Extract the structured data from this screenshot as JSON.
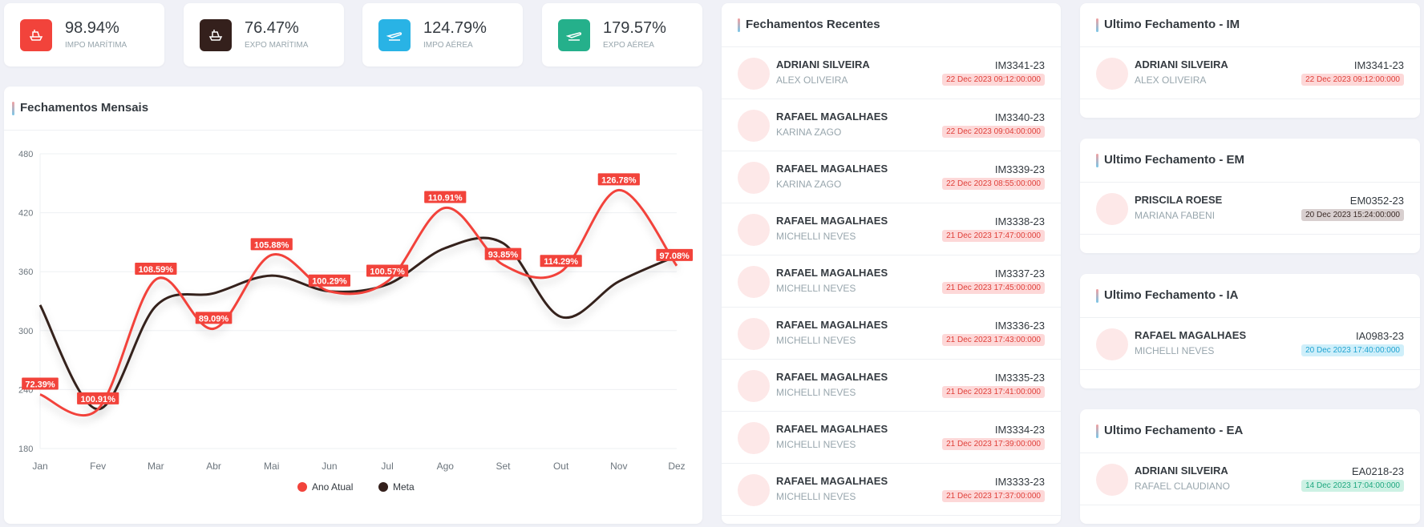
{
  "colors": {
    "red": "#f2433b",
    "dark": "#34201c",
    "blue": "#29b3e5",
    "green": "#25b08b"
  },
  "stats": [
    {
      "value": "98.94%",
      "label": "IMPO MARÍTIMA",
      "icon": "ship-icon",
      "color": "#f2433b"
    },
    {
      "value": "76.47%",
      "label": "EXPO MARÍTIMA",
      "icon": "ship-icon",
      "color": "#34201c"
    },
    {
      "value": "124.79%",
      "label": "IMPO AÉREA",
      "icon": "plane-icon",
      "color": "#29b3e5"
    },
    {
      "value": "179.57%",
      "label": "EXPO AÉREA",
      "icon": "plane-icon",
      "color": "#25b08b"
    }
  ],
  "monthly": {
    "title": "Fechamentos Mensais"
  },
  "chart_data": {
    "type": "line",
    "title": "",
    "categories": [
      "Jan",
      "Fev",
      "Mar",
      "Abr",
      "Mai",
      "Jun",
      "Jul",
      "Ago",
      "Set",
      "Out",
      "Nov",
      "Dez"
    ],
    "ylim": [
      180,
      480
    ],
    "yticks": [
      180,
      240,
      300,
      360,
      420,
      480
    ],
    "grid": true,
    "legend_position": "bottom",
    "series": [
      {
        "name": "Ano Atual",
        "color": "#f2433b",
        "values": [
          235,
          220,
          352,
          302,
          377,
          340,
          350,
          425,
          367,
          360,
          443,
          366
        ]
      },
      {
        "name": "Meta",
        "color": "#34201c",
        "values": [
          326,
          220,
          325,
          338,
          356,
          340,
          347,
          384,
          389,
          314,
          350,
          376
        ]
      }
    ],
    "data_labels": [
      "72.39%",
      "100.91%",
      "108.59%",
      "89.09%",
      "105.88%",
      "100.29%",
      "100.57%",
      "110.91%",
      "93.85%",
      "114.29%",
      "126.78%",
      "97.08%"
    ]
  },
  "recent": {
    "title": "Fechamentos Recentes",
    "items": [
      {
        "name": "ADRIANI SILVEIRA",
        "sub": "ALEX OLIVEIRA",
        "code": "IM3341-23",
        "date": "22 Dec 2023 09:12:00:000",
        "type": "im"
      },
      {
        "name": "RAFAEL MAGALHAES",
        "sub": "KARINA ZAGO",
        "code": "IM3340-23",
        "date": "22 Dec 2023 09:04:00:000",
        "type": "im"
      },
      {
        "name": "RAFAEL MAGALHAES",
        "sub": "KARINA ZAGO",
        "code": "IM3339-23",
        "date": "22 Dec 2023 08:55:00:000",
        "type": "im"
      },
      {
        "name": "RAFAEL MAGALHAES",
        "sub": "MICHELLI NEVES",
        "code": "IM3338-23",
        "date": "21 Dec 2023 17:47:00:000",
        "type": "im"
      },
      {
        "name": "RAFAEL MAGALHAES",
        "sub": "MICHELLI NEVES",
        "code": "IM3337-23",
        "date": "21 Dec 2023 17:45:00:000",
        "type": "im"
      },
      {
        "name": "RAFAEL MAGALHAES",
        "sub": "MICHELLI NEVES",
        "code": "IM3336-23",
        "date": "21 Dec 2023 17:43:00:000",
        "type": "im"
      },
      {
        "name": "RAFAEL MAGALHAES",
        "sub": "MICHELLI NEVES",
        "code": "IM3335-23",
        "date": "21 Dec 2023 17:41:00:000",
        "type": "im"
      },
      {
        "name": "RAFAEL MAGALHAES",
        "sub": "MICHELLI NEVES",
        "code": "IM3334-23",
        "date": "21 Dec 2023 17:39:00:000",
        "type": "im"
      },
      {
        "name": "RAFAEL MAGALHAES",
        "sub": "MICHELLI NEVES",
        "code": "IM3333-23",
        "date": "21 Dec 2023 17:37:00:000",
        "type": "im"
      }
    ]
  },
  "last": [
    {
      "title": "Ultimo Fechamento - IM",
      "name": "ADRIANI SILVEIRA",
      "sub": "ALEX OLIVEIRA",
      "code": "IM3341-23",
      "date": "22 Dec 2023 09:12:00:000",
      "type": "im"
    },
    {
      "title": "Ultimo Fechamento - EM",
      "name": "PRISCILA ROESE",
      "sub": "MARIANA FABENI",
      "code": "EM0352-23",
      "date": "20 Dec 2023 15:24:00:000",
      "type": "em"
    },
    {
      "title": "Ultimo Fechamento - IA",
      "name": "RAFAEL MAGALHAES",
      "sub": "MICHELLI NEVES",
      "code": "IA0983-23",
      "date": "20 Dec 2023 17:40:00:000",
      "type": "ia"
    },
    {
      "title": "Ultimo Fechamento - EA",
      "name": "ADRIANI SILVEIRA",
      "sub": "RAFAEL CLAUDIANO",
      "code": "EA0218-23",
      "date": "14 Dec 2023 17:04:00:000",
      "type": "ea"
    }
  ],
  "badge_styles": {
    "im": {
      "bg": "#fdd8d8",
      "fg": "#e0403a"
    },
    "em": {
      "bg": "#d8cfcf",
      "fg": "#3a2a26"
    },
    "ia": {
      "bg": "#cfeffa",
      "fg": "#1fa3d1"
    },
    "ea": {
      "bg": "#cdf1e4",
      "fg": "#1ea77f"
    }
  }
}
